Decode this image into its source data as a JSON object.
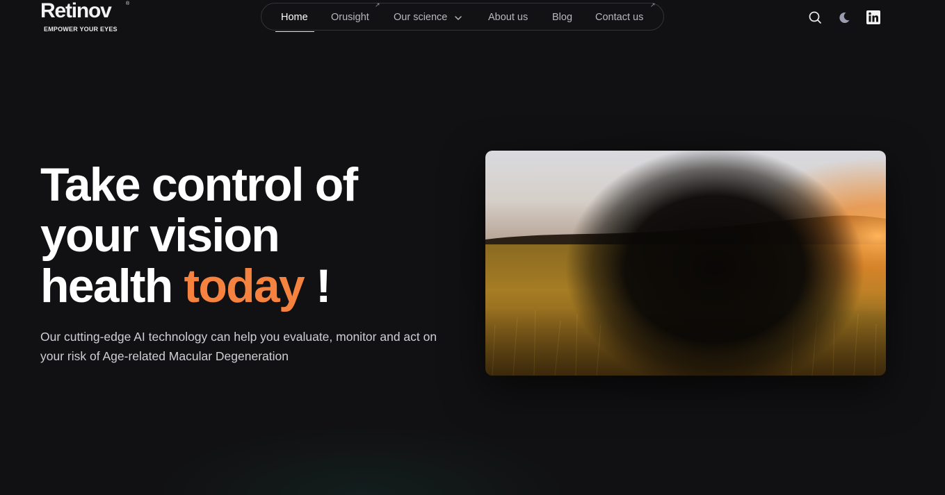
{
  "brand": {
    "name": "Retinov",
    "registered": "®",
    "tagline": "EMPOWER YOUR EYES"
  },
  "nav": {
    "items": [
      {
        "label": "Home",
        "active": true
      },
      {
        "label": "Orusight",
        "external": true,
        "ext_icon": "↗"
      },
      {
        "label": "Our science",
        "dropdown": true
      },
      {
        "label": "About us"
      },
      {
        "label": "Blog"
      },
      {
        "label": "Contact us",
        "external": true,
        "ext_icon": "↗"
      }
    ]
  },
  "header_icons": [
    "search-icon",
    "moon-icon",
    "linkedin-icon"
  ],
  "hero": {
    "title_line1": "Take control of",
    "title_line2": "your vision",
    "title_line3_pre": "health ",
    "title_accent": "today",
    "title_line3_post": " !",
    "subtitle": "Our cutting-edge AI technology can help you evaluate, monitor and act on your risk of Age-related Macular Degeneration"
  },
  "colors": {
    "background": "#111113",
    "accent": "#f5823f",
    "text": "#ffffff",
    "muted": "#b8b8be"
  }
}
